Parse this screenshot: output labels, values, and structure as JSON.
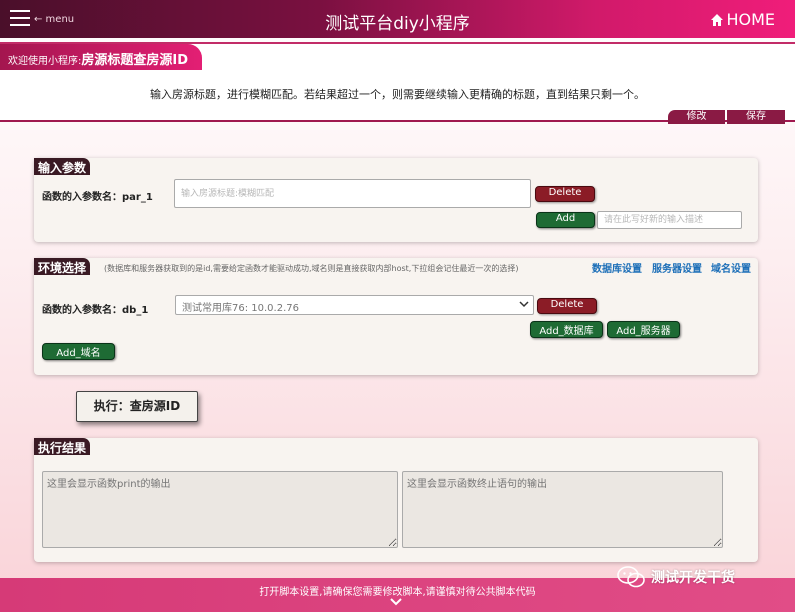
{
  "header": {
    "menu_label": "← menu",
    "title": "测试平台diy小程序",
    "home_label": "HOME"
  },
  "info": {
    "welcome_prefix": "欢迎使用小程序:",
    "program_name": "房源标题查房源ID",
    "description": "输入房源标题，进行模糊匹配。若结果超过一个，则需要继续输入更精确的标题，直到结果只剩一个。",
    "edit_label": "修改",
    "save_label": "保存"
  },
  "params": {
    "section_title": "输入参数",
    "param_label": "函数的入参数名：par_1",
    "input_placeholder": "输入房源标题:模糊匹配",
    "delete_label": "Delete",
    "add_label": "Add",
    "desc_placeholder": "请在此写好新的输入描述"
  },
  "env": {
    "section_title": "环境选择",
    "hint": "(数据库和服务器获取到的是id,需要给定函数才能驱动成功,域名则是直接获取内部host,下拉组会记住最近一次的选择)",
    "links": [
      "数据库设置",
      "服务器设置",
      "域名设置"
    ],
    "param_label": "函数的入参数名：db_1",
    "selected_option": "测试常用库76: 10.0.2.76",
    "delete_label": "Delete",
    "add_db_label": "Add_数据库",
    "add_server_label": "Add_服务器",
    "add_domain_label": "Add_域名"
  },
  "execute": {
    "button_label": "执行：查房源ID"
  },
  "results": {
    "section_title": "执行结果",
    "print_placeholder": "这里会显示函数print的输出",
    "return_placeholder": "这里会显示函数终止语句的输出"
  },
  "footer": {
    "text": "打开脚本设置,请确保您需要修改脚本,请谨慎对待公共脚本代码"
  },
  "watermark": {
    "text": "测试开发干货"
  },
  "colors": {
    "header_dark": "#4a0f2a",
    "header_bright": "#f01d7a",
    "delete_red": "#8b1c26",
    "add_green": "#1e6b34",
    "link_blue": "#1d6fb8",
    "footer_pink": "#d63a77"
  },
  "icons": [
    "hamburger-icon",
    "home-icon",
    "chevron-down-icon",
    "wechat-icon"
  ]
}
